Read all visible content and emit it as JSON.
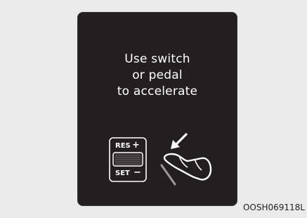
{
  "display": {
    "message_lines": [
      "Use switch",
      "or pedal",
      "to accelerate"
    ]
  },
  "switch": {
    "res_label": "RES",
    "res_symbol": "+",
    "set_label": "SET",
    "set_symbol": "−"
  },
  "icons": {
    "steering_switch": "res-set-switch-icon",
    "pedal": "foot-on-accelerator-pedal-icon",
    "arrow": "down-left-arrow-icon"
  },
  "colors": {
    "background": "#ebebeb",
    "display_background": "#231f20",
    "text": "#ffffff",
    "icon_stroke": "#ffffff",
    "pedal_line": "#9a9a9a"
  },
  "figure_code": "OOSH069118L"
}
